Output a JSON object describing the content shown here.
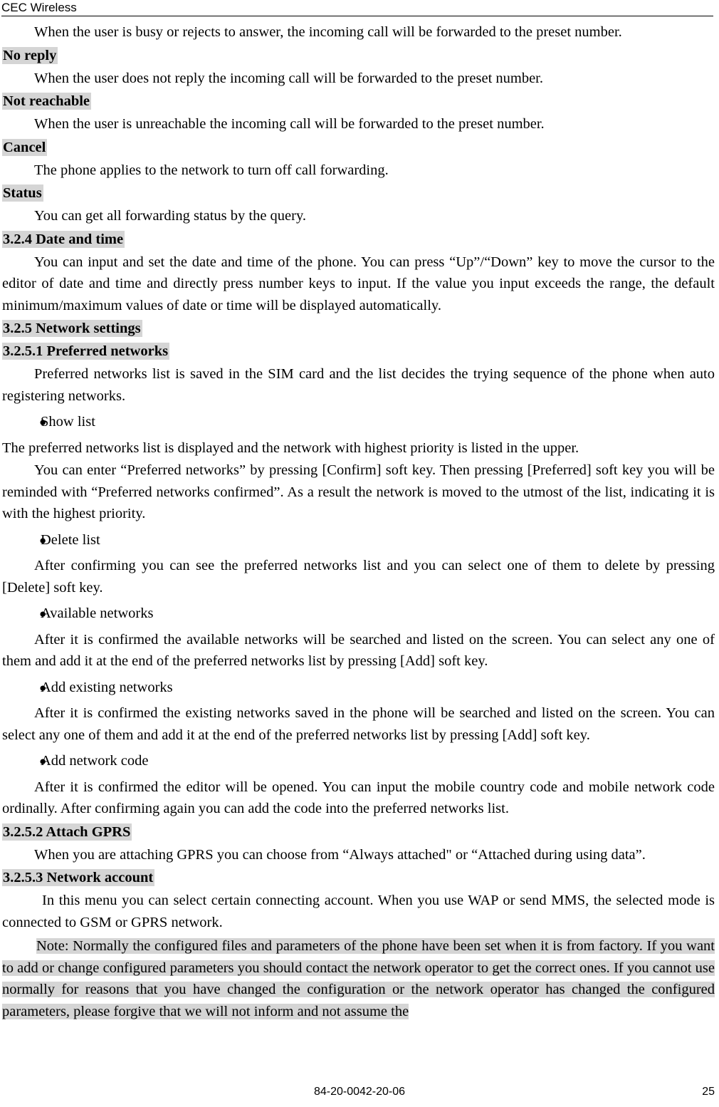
{
  "header": {
    "title": "CEC Wireless"
  },
  "content": {
    "p_busy": "When the user is busy or rejects to answer, the incoming call will be forwarded to the preset number.",
    "h_no_reply": "No reply",
    "p_no_reply": "When the user does not reply the incoming call will be forwarded to the preset number.",
    "h_not_reachable": "Not reachable",
    "p_not_reachable": "When the user is unreachable the incoming call will be forwarded to the preset number.",
    "h_cancel": "Cancel",
    "p_cancel": "The phone applies to the network to turn off call forwarding.",
    "h_status": "Status",
    "p_status": "You can get all forwarding status by the query.",
    "h_date_time": "3.2.4 Date and time",
    "p_date_time": "You can input and set the date and time of the phone. You can press “Up”/“Down” key to move the cursor to the editor of date and time and directly press number keys to input. If the value you input exceeds the range, the default minimum/maximum values of date or time will be displayed automatically.",
    "h_network_settings": "3.2.5 Network settings",
    "h_preferred_networks": "3.2.5.1 Preferred networks",
    "p_preferred_intro": "Preferred networks list is saved in the SIM card and the list decides the trying sequence of the phone when auto registering networks.",
    "bullet_glyph": "●",
    "b_show_list": "Show list",
    "p_show_list_1": "The preferred networks list is displayed and the network with highest priority is listed in the upper.",
    "p_show_list_2": "You can enter “Preferred networks” by pressing [Confirm] soft key. Then pressing [Preferred] soft key you will be reminded with “Preferred networks confirmed”. As a result the network is moved to the utmost of the list, indicating it is with the highest priority.",
    "b_delete_list": "Delete list",
    "p_delete_list": "After confirming you can see the preferred networks list and you can select one of them to delete by pressing [Delete] soft key.",
    "b_available_networks": "Available networks",
    "p_available_networks": "After it is confirmed the available networks will be searched and listed on the screen. You can select any one of them and add it at the end of the preferred networks list by pressing [Add] soft key.",
    "b_add_existing_networks": "Add existing networks",
    "p_add_existing_networks": "After it is confirmed the existing networks saved in the phone will be searched and listed on the screen. You can select any one of them and add it at the end of the preferred networks list by pressing [Add] soft key.",
    "b_add_network_code": "Add network code",
    "p_add_network_code": "After it is confirmed the editor will be opened. You can input the mobile country code and mobile network code ordinally. After confirming again you can add the code into the preferred networks list.",
    "h_attach_gprs": "3.2.5.2 Attach GPRS",
    "p_attach_gprs": "When you are attaching GPRS you can choose from “Always attached\" or “Attached during using data”.",
    "h_network_account": "3.2.5.3 Network account",
    "p_network_account": "In this menu you can select certain connecting account. When you use WAP or send MMS, the selected mode is connected to GSM or GPRS network.",
    "p_note": "Note: Normally the configured files and parameters of the phone have been set when it is from factory. If you want to add or change configured parameters you should contact the network operator to get the correct ones. If you cannot use normally for reasons that you have changed the configuration or the network operator has changed the configured parameters, please forgive that we will not inform and not assume the"
  },
  "footer": {
    "doc_id": "84-20-0042-20-06",
    "page_number": "25"
  },
  "colors": {
    "highlight": "#d5d5d5",
    "text": "#000000",
    "page": "#ffffff"
  }
}
